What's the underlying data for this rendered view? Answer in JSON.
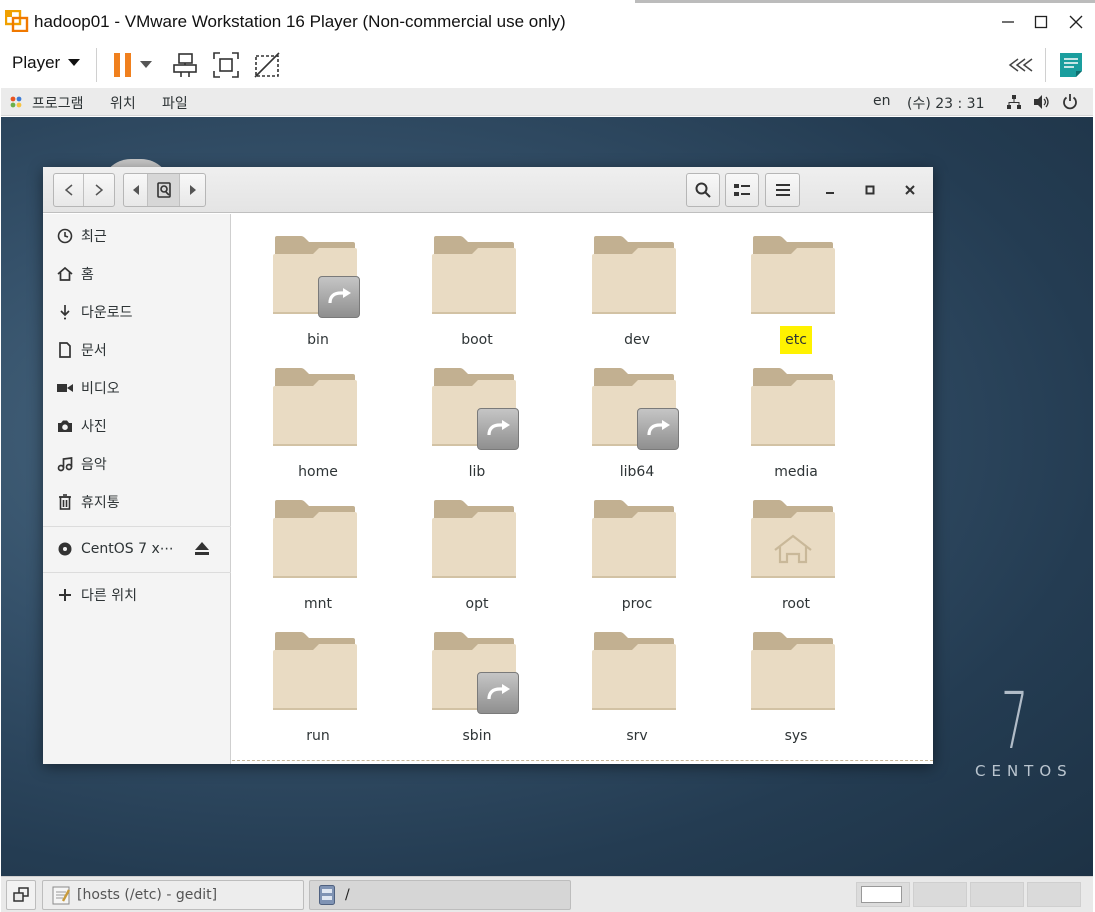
{
  "vm": {
    "title": "hadoop01 - VMware Workstation 16 Player (Non-commercial use only)",
    "player_menu": "Player",
    "accent_orange": "#f0801e",
    "accent_teal": "#1a9e9e",
    "icons": [
      "vmware-logo-icon",
      "pause-icon",
      "dropdown-arrow-icon",
      "send-ctrl-alt-del-icon",
      "fullscreen-icon",
      "unity-icon",
      "collapse-left-icon",
      "notes-icon"
    ]
  },
  "panel": {
    "apps": "프로그램",
    "places": "위치",
    "app_menu": "파일",
    "keyboard": "en",
    "clock": "(수) 23 : 31"
  },
  "desktop": {
    "brand_number": "7",
    "brand_text": "CENTOS"
  },
  "sidebar": {
    "items": [
      {
        "label": "최근",
        "icon": "recent-icon"
      },
      {
        "label": "홈",
        "icon": "home-icon"
      },
      {
        "label": "다운로드",
        "icon": "download-icon"
      },
      {
        "label": "문서",
        "icon": "document-icon"
      },
      {
        "label": "비디오",
        "icon": "video-icon"
      },
      {
        "label": "사진",
        "icon": "camera-icon"
      },
      {
        "label": "음악",
        "icon": "music-icon"
      },
      {
        "label": "휴지통",
        "icon": "trash-icon"
      }
    ],
    "device": {
      "label": "CentOS 7 x⋯",
      "icon": "disc-icon"
    },
    "other": {
      "label": "다른 위치",
      "icon": "plus-icon"
    }
  },
  "folders": [
    {
      "name": "bin",
      "link": true,
      "home": false,
      "highlight": false
    },
    {
      "name": "boot",
      "link": false,
      "home": false,
      "highlight": false
    },
    {
      "name": "dev",
      "link": false,
      "home": false,
      "highlight": false
    },
    {
      "name": "etc",
      "link": false,
      "home": false,
      "highlight": true
    },
    {
      "name": "home",
      "link": false,
      "home": false,
      "highlight": false
    },
    {
      "name": "lib",
      "link": true,
      "home": false,
      "highlight": false
    },
    {
      "name": "lib64",
      "link": true,
      "home": false,
      "highlight": false
    },
    {
      "name": "media",
      "link": false,
      "home": false,
      "highlight": false
    },
    {
      "name": "mnt",
      "link": false,
      "home": false,
      "highlight": false
    },
    {
      "name": "opt",
      "link": false,
      "home": false,
      "highlight": false
    },
    {
      "name": "proc",
      "link": false,
      "home": false,
      "highlight": false
    },
    {
      "name": "root",
      "link": false,
      "home": true,
      "highlight": false
    },
    {
      "name": "run",
      "link": false,
      "home": false,
      "highlight": false
    },
    {
      "name": "sbin",
      "link": true,
      "home": false,
      "highlight": false
    },
    {
      "name": "srv",
      "link": false,
      "home": false,
      "highlight": false
    },
    {
      "name": "sys",
      "link": false,
      "home": false,
      "highlight": false
    }
  ],
  "taskbar": {
    "window1": "[hosts (/etc) - gedit]",
    "window2": "/"
  }
}
